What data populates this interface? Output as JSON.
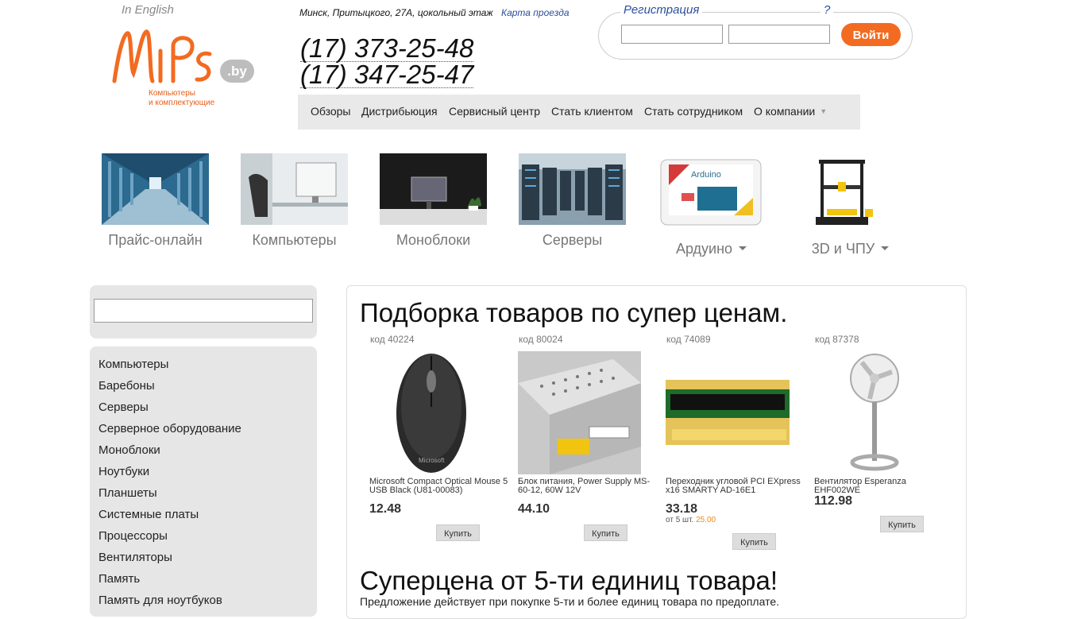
{
  "header": {
    "lang_link": "In English",
    "logo_tagline_1": "Компьютеры",
    "logo_tagline_2": "и комплектующие",
    "logo_domain": ".by",
    "address": "Минск, Притыцкого, 27А, цокольный этаж",
    "map_link": "Карта проезда",
    "phone1": "(17) 373-25-48",
    "phone2": "(17) 347-25-47"
  },
  "login": {
    "legend": "Регистрация",
    "help": "?",
    "login_value": "",
    "password_value": "",
    "button": "Войти"
  },
  "topmenu": {
    "items": [
      "Обзоры",
      "Дистрибьюция",
      "Сервисный центр",
      "Стать клиентом",
      "Стать сотрудником",
      "О компании"
    ]
  },
  "tiles": [
    {
      "label": "Прайс-онлайн"
    },
    {
      "label": "Компьютеры"
    },
    {
      "label": "Моноблоки"
    },
    {
      "label": "Серверы"
    },
    {
      "label": "Ардуино"
    },
    {
      "label": "3D и ЧПУ"
    }
  ],
  "sidebar": {
    "search_value": "",
    "categories": [
      "Компьютеры",
      "Баребоны",
      "Серверы",
      "Серверное оборудование",
      "Моноблоки",
      "Ноутбуки",
      "Планшеты",
      "Системные платы",
      "Процессоры",
      "Вентиляторы",
      "Память",
      "Память для ноутбуков"
    ]
  },
  "main": {
    "title1": "Подборка товаров по супер ценам.",
    "title2": "Суперцена от 5-ти единиц товара!",
    "offer_text": "Предложение действует при покупке 5-ти и более единиц товара по предоплате.",
    "products": [
      {
        "code": "код 40224",
        "name": "Microsoft Compact Optical Mouse 5 USB Black (U81-00083)",
        "price": "12.48",
        "buy": "Купить"
      },
      {
        "code": "код 80024",
        "name": "Блок питания, Power Supply MS-60-12, 60W 12V",
        "price": "44.10",
        "buy": "Купить"
      },
      {
        "code": "код 74089",
        "name": "Переходник угловой PCI EXpress x16 SMARTY AD-16E1",
        "price": "33.18",
        "note_prefix": "от 5 шт.",
        "note_price": "25.00",
        "buy": "Купить"
      },
      {
        "code": "код 87378",
        "name": "Вентилятор Esperanza EHF002WE",
        "price": "112.98",
        "buy": "Купить"
      }
    ]
  },
  "colors": {
    "brand": "#f26b21",
    "link": "#2a4f9e",
    "panel": "#e6e6e6"
  }
}
